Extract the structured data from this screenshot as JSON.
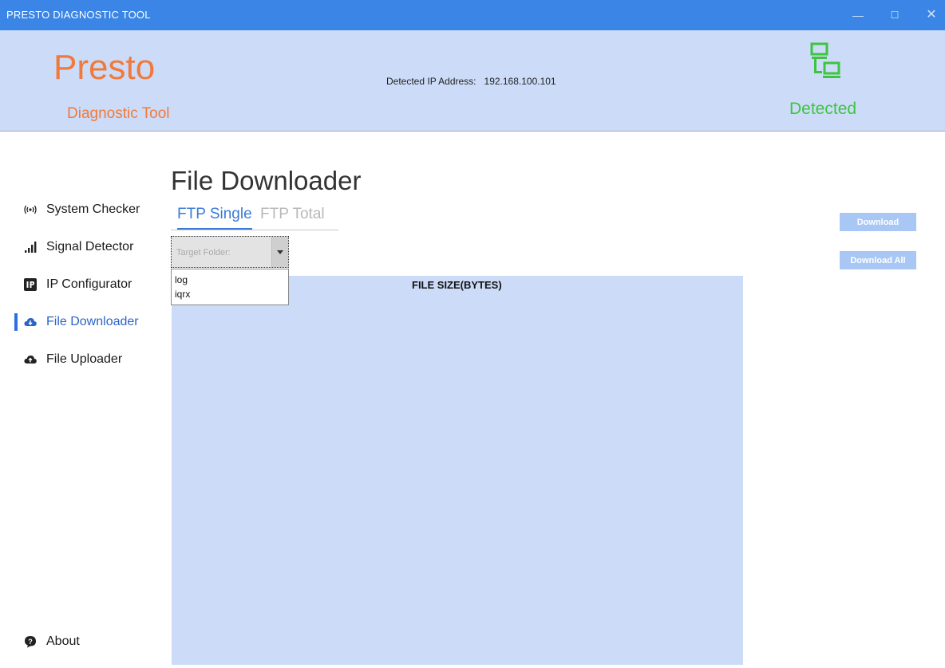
{
  "window": {
    "title": "PRESTO DIAGNOSTIC TOOL",
    "minimize": "—",
    "maximize": "☐",
    "close": "✕"
  },
  "header": {
    "brand": "Presto",
    "subtitle": "Diagnostic Tool",
    "ip_label": "Detected IP Address:",
    "ip_value": "192.168.100.101",
    "status": "Detected",
    "status_icon": "network-connected-icon",
    "status_color": "#3ec441"
  },
  "nav": {
    "items": [
      {
        "label": "System Checker",
        "icon": "broadcast-icon"
      },
      {
        "label": "Signal Detector",
        "icon": "signal-bars-icon"
      },
      {
        "label": "IP Configurator",
        "icon": "ip-badge-icon"
      },
      {
        "label": "File Downloader",
        "icon": "cloud-download-icon",
        "active": true
      },
      {
        "label": "File Uploader",
        "icon": "cloud-upload-icon"
      }
    ],
    "about": {
      "label": "About",
      "icon": "info-bubble-icon"
    }
  },
  "main": {
    "title": "File Downloader",
    "tabs": [
      {
        "label": "FTP Single",
        "active": true
      },
      {
        "label": "FTP Total",
        "active": false
      }
    ],
    "folder_select": {
      "placeholder": "Target Folder:",
      "options": [
        "log",
        "iqrx"
      ]
    },
    "table": {
      "columns": [
        "FILE SIZE(BYTES)"
      ]
    },
    "buttons": {
      "download": "Download",
      "download_all": "Download All"
    }
  },
  "colors": {
    "accent": "#3a85e6",
    "brand": "#f07a3b",
    "panel": "#ccdcf8",
    "button": "#a9c7f5"
  }
}
